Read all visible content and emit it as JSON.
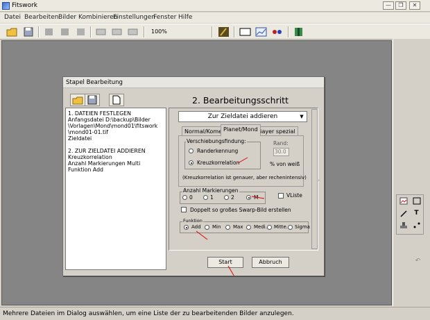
{
  "app": {
    "title": "Fitswork",
    "accent": "#d4d0c8",
    "workspace_color": "#858585"
  },
  "window_controls": {
    "minimize": "—",
    "restore": "❐",
    "close": "✕"
  },
  "menu": [
    "Datei",
    "Bearbeiten",
    "Bilder Kombinieren",
    "Einstellungen",
    "Fenster",
    "Hilfe"
  ],
  "toolbar": {
    "zoom": "100%",
    "icons": [
      "open-folder-icon",
      "save-icon",
      "flip-horizontal-icon",
      "rotate-icon",
      "copy-icon",
      "mono-icon",
      "rgb-icon",
      "split-icon",
      "histogram-icon",
      "monitor-icon",
      "graph-icon",
      "magic-icon",
      "book-icon"
    ]
  },
  "dialog": {
    "title": "Stapel Bearbeitung",
    "step_title": "2. Bearbeitungsschritt",
    "list_lines": [
      "1. DATEIEN FESTLEGEN",
      "Anfangsdatei   D:\\backup\\Bilder",
      "\\Vorlagen\\Mond\\mond01\\fitswork",
      "\\mond01-01.tif",
      "Zieldatei",
      "",
      "2. ZUR ZIELDATEI ADDIEREN",
      "Kreuzkorrelation",
      "Anzahl Markierungen   Multi",
      "Funktion   Add"
    ],
    "combo_value": "Zur Zieldatei addieren",
    "tabs": [
      "Normal/Komet",
      "Planet/Mond",
      "Bayer spezial"
    ],
    "active_tab": "Planet/Mond",
    "shift_group": {
      "label": "Verschiebungsfindung:",
      "options": [
        "Randerkennung",
        "Kreuzkorrelation"
      ],
      "selected": "Kreuzkorrelation"
    },
    "rand": {
      "label": "Rand:",
      "value": "30.0",
      "unit": "% von weiß"
    },
    "hint": "(Kreuzkorrelation ist genauer, aber rechenintensiv)",
    "markers": {
      "label": "Anzahl Markierungen",
      "options": [
        "0",
        "1",
        "2",
        "M"
      ],
      "selected": "M"
    },
    "vliste_label": "VListe",
    "double_swarp_label": "Doppelt so großes Swarp-Bild erstellen",
    "function": {
      "label": "Funktion",
      "options": [
        "Add",
        "Min",
        "Max",
        "Medi.",
        "Mitte.",
        "Sigma"
      ],
      "selected": "Add"
    },
    "start_button": "Start",
    "cancel_button": "Abbruch"
  },
  "right_tools": [
    "image-icon",
    "rectangle-icon",
    "pen-icon",
    "text-icon",
    "stamp-icon",
    "points-icon",
    "undo-icon"
  ],
  "status_text": "Mehrere Dateien im Dialog auswählen, um eine Liste der zu bearbeitenden Bilder anzulegen."
}
